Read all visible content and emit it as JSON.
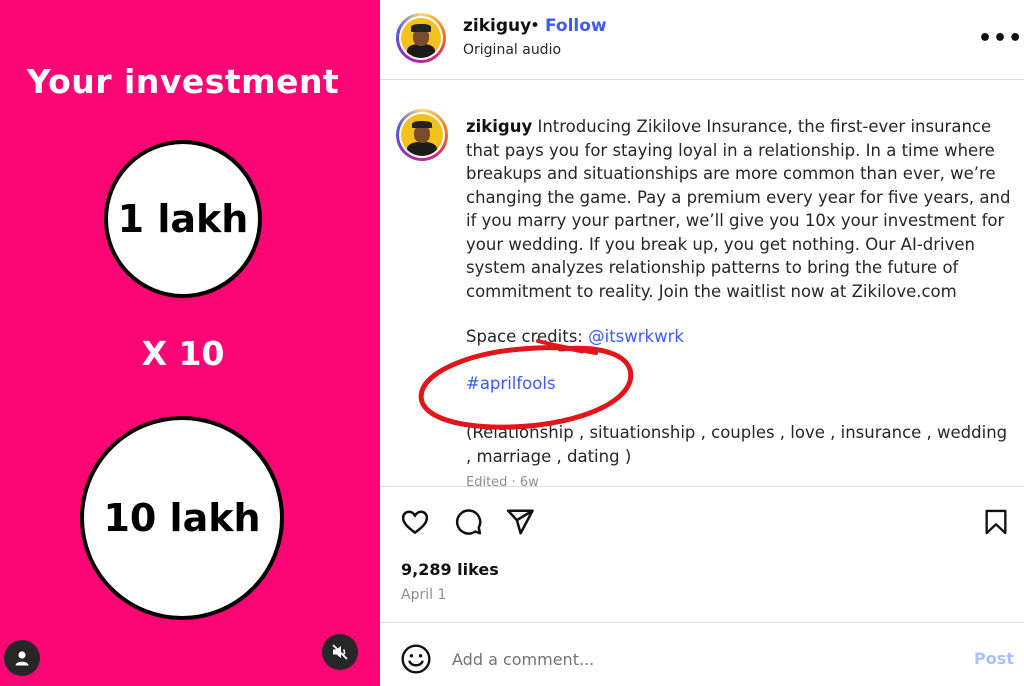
{
  "media": {
    "headline": "Your investment",
    "circle_top": "1 lakh",
    "multiplier": "X 10",
    "circle_bottom": "10 lakh",
    "background": "#fc0575"
  },
  "header": {
    "username": "zikiguy",
    "separator": "•",
    "follow_label": "Follow",
    "audio": "Original audio",
    "more_label": "•••"
  },
  "caption": {
    "username": "zikiguy",
    "text": "Introducing Zikilove Insurance, the first-ever insurance that pays you for staying loyal in a relationship. In a time where breakups and situationships are more common than ever, we’re changing the game. Pay a premium every year for five years, and if you marry your partner, we’ll give you 10x your investment for your wedding. If you break up, you get nothing. Our AI-driven system analyzes relationship patterns to bring the future of commitment to reality. Join the waitlist now at Zikilove.com",
    "credits_prefix": "Space credits: ",
    "credits_mention": "@itswrkwrk",
    "hashtag": "#aprilfools",
    "tags": "(Relationship , situationship , couples , love , insurance , wedding , marriage , dating )",
    "edited": "Edited · 6w"
  },
  "stats": {
    "likes": "9,289 likes",
    "date": "April 1"
  },
  "comment_box": {
    "placeholder": "Add a comment...",
    "post_label": "Post"
  },
  "colors": {
    "accent": "#3d5afe",
    "annotation": "#e0161c",
    "post_disabled": "#a7c1ff"
  }
}
